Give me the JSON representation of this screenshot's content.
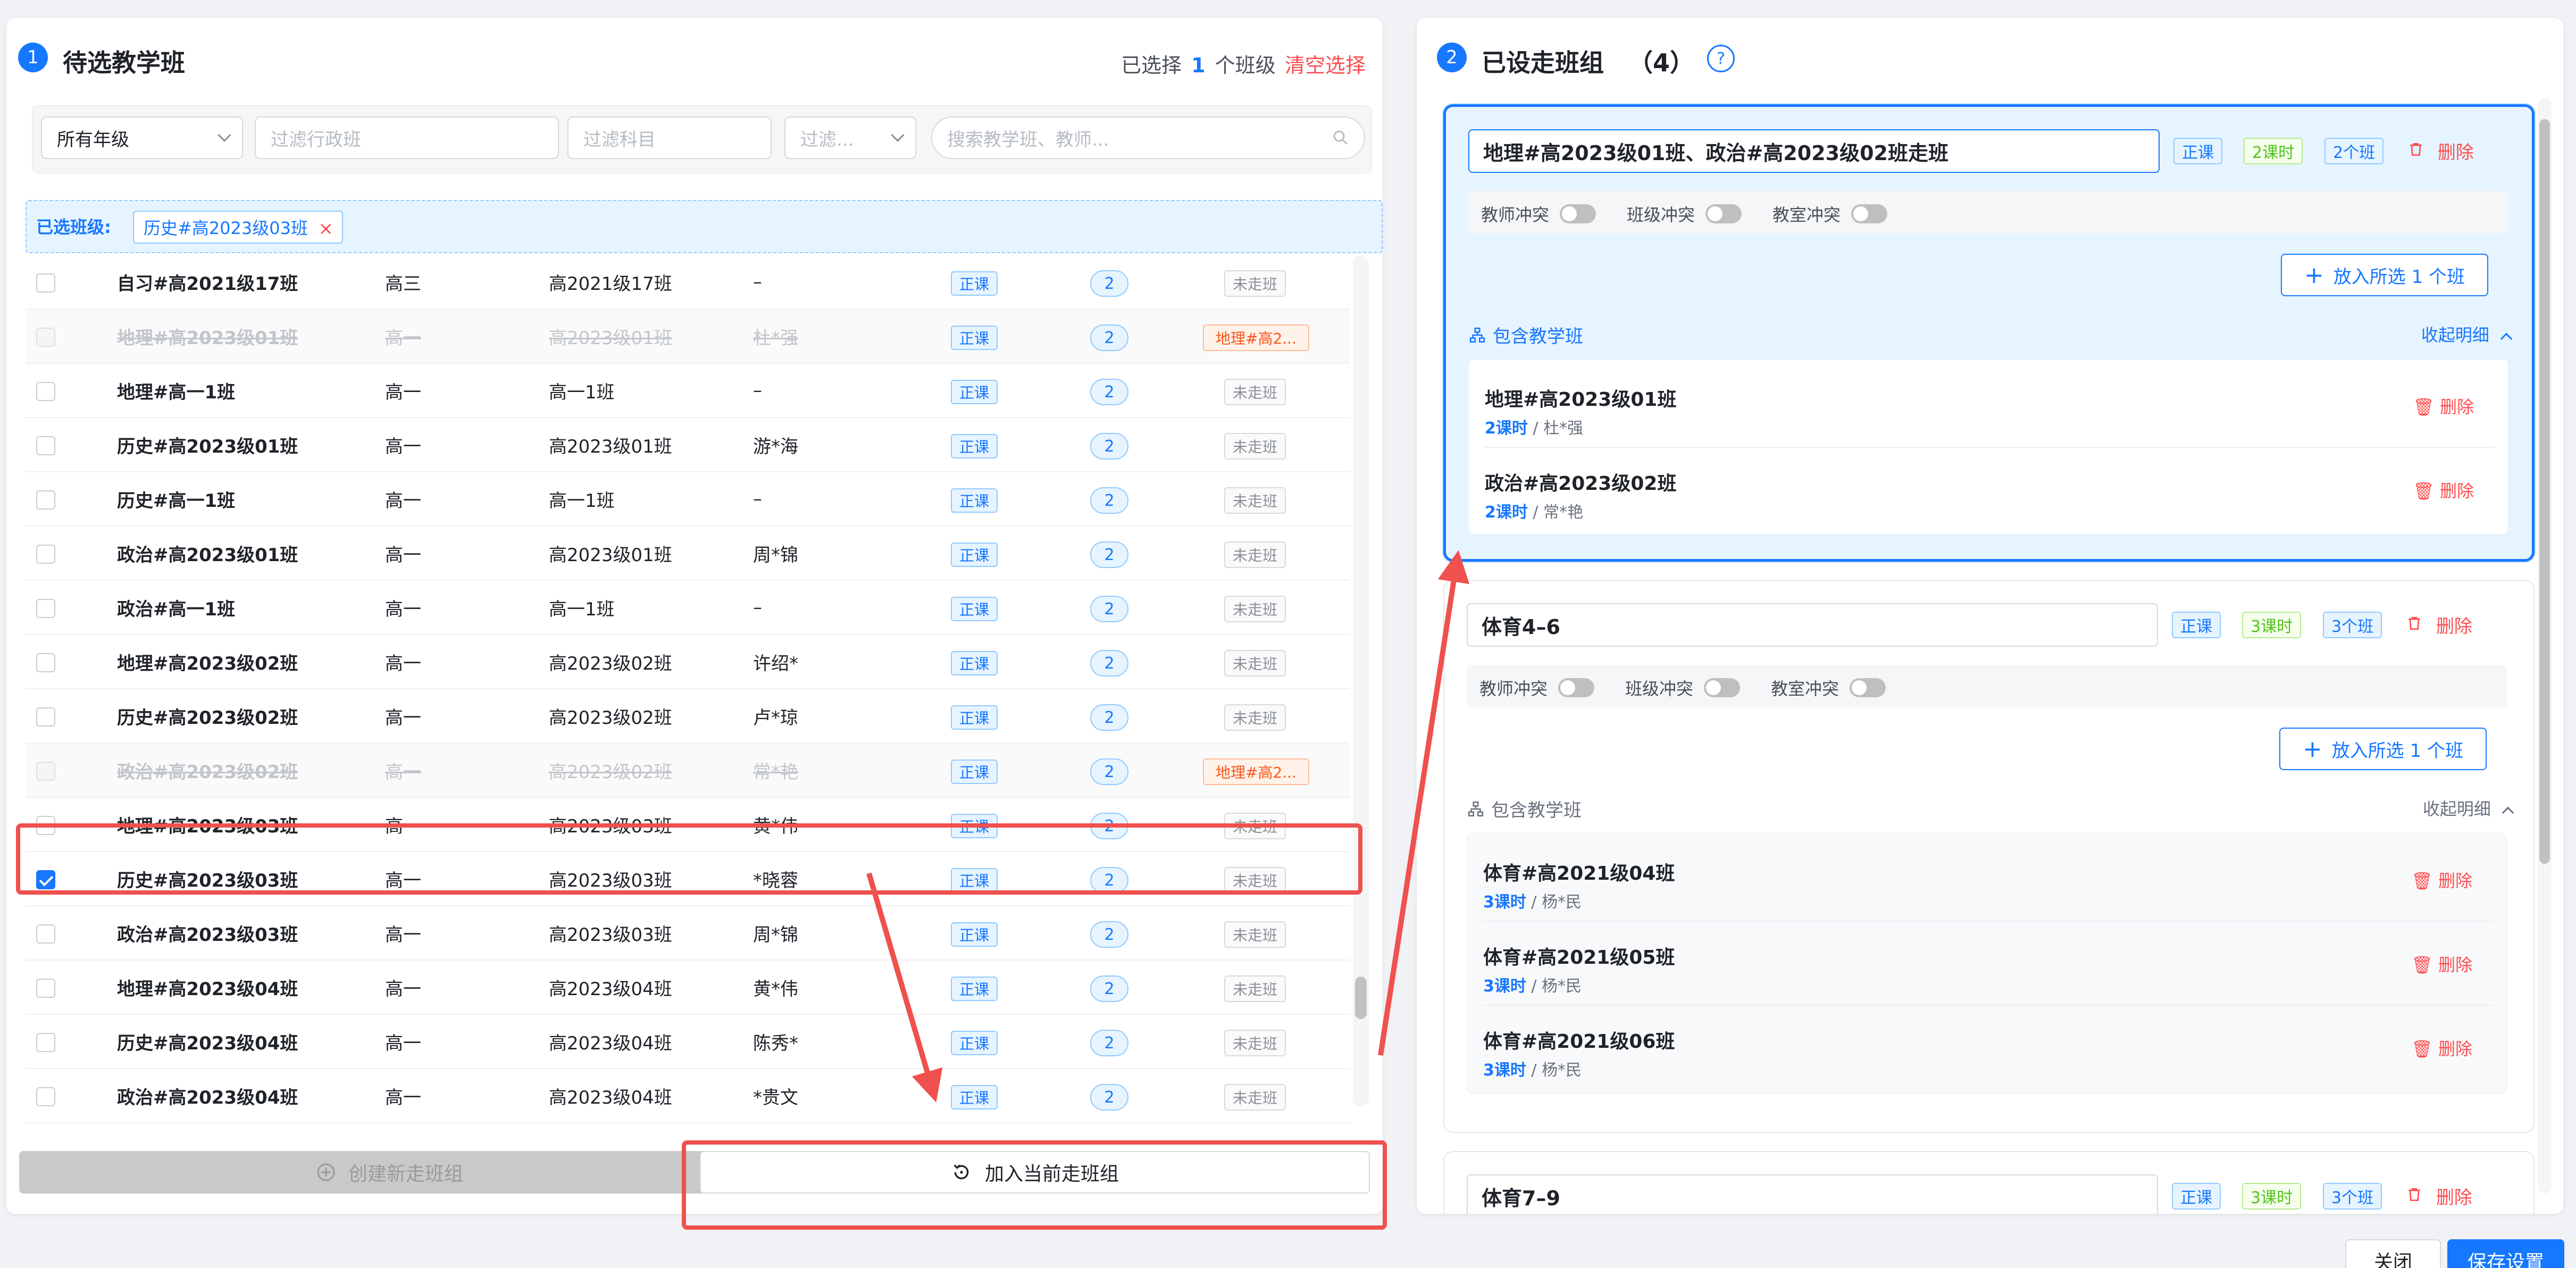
{
  "left": {
    "step": "1",
    "title": "待选教学班",
    "selected_prefix": "已选择",
    "selected_count": "1",
    "selected_suffix": "个班级",
    "clear_label": "清空选择",
    "filters": {
      "grade": "所有年级",
      "admin_class_placeholder": "过滤行政班",
      "subject_placeholder": "过滤科目",
      "status_placeholder": "过滤...",
      "search_placeholder": "搜索教学班、教师..."
    },
    "selected_label": "已选班级:",
    "selected_chip": "历史#高2023级03班",
    "chip_close": "×",
    "rows": [
      {
        "name": "自习#高2021级17班",
        "grade": "高三",
        "admin": "高2021级17班",
        "teacher": "–",
        "type": "正课",
        "hours": "2",
        "status": "未走班",
        "disabled": false,
        "checked": false
      },
      {
        "name": "地理#高2023级01班",
        "grade": "高一",
        "admin": "高2023级01班",
        "teacher": "杜*强",
        "type": "正课",
        "hours": "2",
        "status": "地理#高2...",
        "disabled": true,
        "checked": false
      },
      {
        "name": "地理#高一1班",
        "grade": "高一",
        "admin": "高一1班",
        "teacher": "–",
        "type": "正课",
        "hours": "2",
        "status": "未走班",
        "disabled": false,
        "checked": false
      },
      {
        "name": "历史#高2023级01班",
        "grade": "高一",
        "admin": "高2023级01班",
        "teacher": "游*海",
        "type": "正课",
        "hours": "2",
        "status": "未走班",
        "disabled": false,
        "checked": false
      },
      {
        "name": "历史#高一1班",
        "grade": "高一",
        "admin": "高一1班",
        "teacher": "–",
        "type": "正课",
        "hours": "2",
        "status": "未走班",
        "disabled": false,
        "checked": false
      },
      {
        "name": "政治#高2023级01班",
        "grade": "高一",
        "admin": "高2023级01班",
        "teacher": "周*锦",
        "type": "正课",
        "hours": "2",
        "status": "未走班",
        "disabled": false,
        "checked": false
      },
      {
        "name": "政治#高一1班",
        "grade": "高一",
        "admin": "高一1班",
        "teacher": "–",
        "type": "正课",
        "hours": "2",
        "status": "未走班",
        "disabled": false,
        "checked": false
      },
      {
        "name": "地理#高2023级02班",
        "grade": "高一",
        "admin": "高2023级02班",
        "teacher": "许绍*",
        "type": "正课",
        "hours": "2",
        "status": "未走班",
        "disabled": false,
        "checked": false
      },
      {
        "name": "历史#高2023级02班",
        "grade": "高一",
        "admin": "高2023级02班",
        "teacher": "卢*琼",
        "type": "正课",
        "hours": "2",
        "status": "未走班",
        "disabled": false,
        "checked": false
      },
      {
        "name": "政治#高2023级02班",
        "grade": "高一",
        "admin": "高2023级02班",
        "teacher": "常*艳",
        "type": "正课",
        "hours": "2",
        "status": "地理#高2...",
        "disabled": true,
        "checked": false
      },
      {
        "name": "地理#高2023级03班",
        "grade": "高一",
        "admin": "高2023级03班",
        "teacher": "黄*伟",
        "type": "正课",
        "hours": "2",
        "status": "未走班",
        "disabled": false,
        "checked": false
      },
      {
        "name": "历史#高2023级03班",
        "grade": "高一",
        "admin": "高2023级03班",
        "teacher": "*晓蓉",
        "type": "正课",
        "hours": "2",
        "status": "未走班",
        "disabled": false,
        "checked": true
      },
      {
        "name": "政治#高2023级03班",
        "grade": "高一",
        "admin": "高2023级03班",
        "teacher": "周*锦",
        "type": "正课",
        "hours": "2",
        "status": "未走班",
        "disabled": false,
        "checked": false
      },
      {
        "name": "地理#高2023级04班",
        "grade": "高一",
        "admin": "高2023级04班",
        "teacher": "黄*伟",
        "type": "正课",
        "hours": "2",
        "status": "未走班",
        "disabled": false,
        "checked": false
      },
      {
        "name": "历史#高2023级04班",
        "grade": "高一",
        "admin": "高2023级04班",
        "teacher": "陈秀*",
        "type": "正课",
        "hours": "2",
        "status": "未走班",
        "disabled": false,
        "checked": false
      },
      {
        "name": "政治#高2023级04班",
        "grade": "高一",
        "admin": "高2023级04班",
        "teacher": "*贵文",
        "type": "正课",
        "hours": "2",
        "status": "未走班",
        "disabled": false,
        "checked": false
      }
    ],
    "create_label": "创建新走班组",
    "add_current_label": "加入当前走班组"
  },
  "right": {
    "step": "2",
    "title": "已设走班组",
    "count": "（4）",
    "help_icon": "?",
    "groups": [
      {
        "name": "地理#高2023级01班、政治#高2023级02班走班",
        "type": "正课",
        "hours": "2课时",
        "count": "2个班",
        "delete": "删除",
        "conf": [
          "教师冲突",
          "班级冲突",
          "教室冲突"
        ],
        "add_label": "放入所选 1 个班",
        "include_label": "包含教学班",
        "collapse_label": "收起明细",
        "members": [
          {
            "name": "地理#高2023级01班",
            "hours": "2课时",
            "teacher": "杜*强",
            "delete": "删除"
          },
          {
            "name": "政治#高2023级02班",
            "hours": "2课时",
            "teacher": "常*艳",
            "delete": "删除"
          }
        ]
      },
      {
        "name": "体育4–6",
        "type": "正课",
        "hours": "3课时",
        "count": "3个班",
        "delete": "删除",
        "conf": [
          "教师冲突",
          "班级冲突",
          "教室冲突"
        ],
        "add_label": "放入所选 1 个班",
        "include_label": "包含教学班",
        "collapse_label": "收起明细",
        "members": [
          {
            "name": "体育#高2021级04班",
            "hours": "3课时",
            "teacher": "杨*民",
            "delete": "删除"
          },
          {
            "name": "体育#高2021级05班",
            "hours": "3课时",
            "teacher": "杨*民",
            "delete": "删除"
          },
          {
            "name": "体育#高2021级06班",
            "hours": "3课时",
            "teacher": "杨*民",
            "delete": "删除"
          }
        ]
      },
      {
        "name": "体育7–9",
        "type": "正课",
        "hours": "3课时",
        "count": "3个班",
        "delete": "删除"
      }
    ]
  },
  "footer": {
    "close_label": "关闭",
    "save_label": "保存设置"
  },
  "colors": {
    "accent": "#1677ff",
    "danger": "#ff4d4f",
    "annotation": "#f0504e",
    "success": "#52c41a",
    "warning": "#fa541c"
  }
}
